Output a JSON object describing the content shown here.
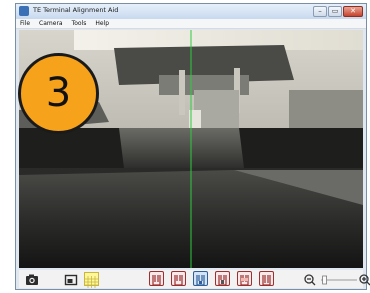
{
  "window": {
    "title": "TE Terminal Alignment Aid",
    "controls": {
      "minimize": "–",
      "maximize": "▭",
      "close": "✕"
    }
  },
  "menu": [
    "File",
    "Camera",
    "Tools",
    "Help"
  ],
  "camera": {
    "step_number": "3",
    "badge_color": "#f7a21b",
    "crosshair_color": "#2ecc40"
  },
  "toolbar": {
    "icons": [
      "camera-icon",
      "display-icon",
      "grid-icon"
    ],
    "steps": [
      {
        "icon": "terminal-step-1-icon",
        "active": false
      },
      {
        "icon": "terminal-step-2-icon",
        "active": false
      },
      {
        "icon": "terminal-step-3-icon",
        "active": true
      },
      {
        "icon": "terminal-step-4-icon",
        "active": false
      },
      {
        "icon": "terminal-step-5-icon",
        "active": false
      },
      {
        "icon": "terminal-step-6-icon",
        "active": false
      }
    ],
    "zoom": {
      "out_icon": "zoom-out-icon",
      "in_icon": "zoom-in-icon",
      "level": 0.05
    }
  }
}
